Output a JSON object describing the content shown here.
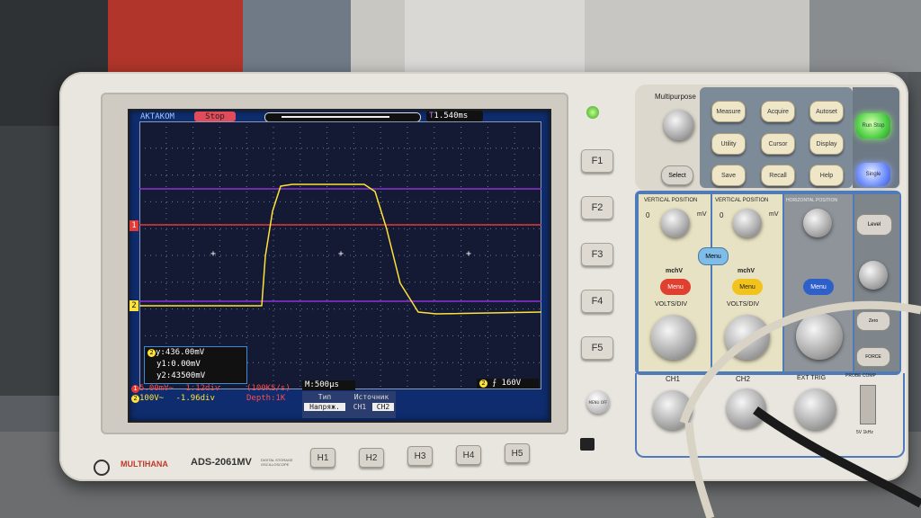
{
  "screen": {
    "brand": "АКТАКОМ",
    "run_state": "Stop",
    "trigger_time": "1.540ms",
    "cursor_readout": [
      "y:436.00mV",
      "y1:0.00mV",
      "y2:43500mV"
    ],
    "ch1_line": {
      "volts": "5.00mV~",
      "offset": "1.12div"
    },
    "ch2_line": {
      "volts": "100V~",
      "offset": "-1.96div"
    },
    "sample_rate": "(100KS/s)",
    "depth": "Depth:1K",
    "timebase": "M:500µs",
    "trigger_level": "160V",
    "menu": {
      "type_label": "Тип",
      "type_value": "Напряж.",
      "source_label": "Источник",
      "source_options": [
        "CH1",
        "CH2"
      ]
    },
    "markers": {
      "ch1": "1",
      "ch2": "2",
      "trig": "T"
    }
  },
  "soft_keys": [
    "F1",
    "F2",
    "F3",
    "F4",
    "F5"
  ],
  "h_keys": [
    "H1",
    "H2",
    "H3",
    "H4",
    "H5"
  ],
  "menu_off_label": "MENU OFF",
  "branding": {
    "logo": "MULTIHANA",
    "model": "ADS-2061MV",
    "desc": "DIGITAL STORAGE OSCILLOSCOPE"
  },
  "controls": {
    "multipurpose": "Multipurpose",
    "select": "Select",
    "top_buttons": [
      "Measure",
      "Acquire",
      "Autoset",
      "Utility",
      "Cursor",
      "Display",
      "Save",
      "Recall",
      "Help"
    ],
    "run_stop": "Run Stop",
    "single": "Single",
    "vertical_position": "VERTICAL POSITION",
    "horizontal_position": "HORIZONTAL POSITION",
    "mv": "mV",
    "zero": "0",
    "menu": "Menu",
    "mchv": "mchV",
    "volts_div": "VOLTS/DIV",
    "ch1": "CH1",
    "ch2": "CH2",
    "ext_trig": "EXT TRIG",
    "probe_comp": "PROBE COMP",
    "probe_spec": "5V 1kHz",
    "level": "Level",
    "force": "FORCE",
    "zero_btn": "Zero"
  },
  "colors": {
    "ch1": "#ffe23a",
    "ch2": "#e53935",
    "cursor": "#8a35d6",
    "screen": "#0f2d6e",
    "run_green": "#4fd146",
    "single_blue": "#6f8fff"
  }
}
